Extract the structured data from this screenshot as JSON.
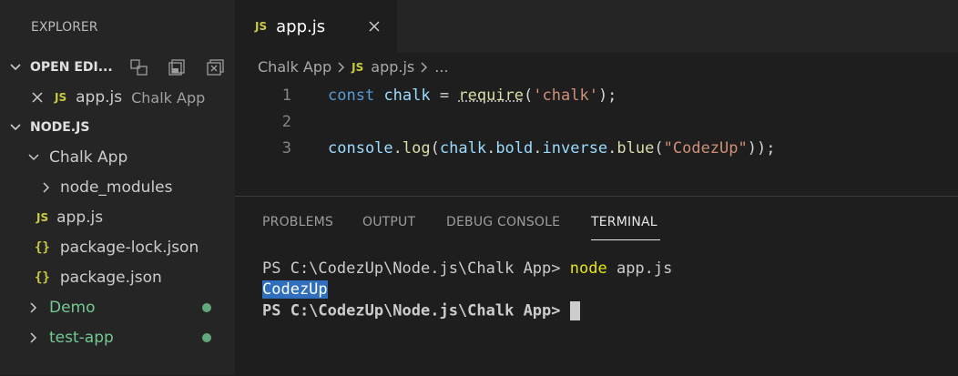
{
  "sidebar": {
    "title": "EXPLORER",
    "open_editors": {
      "label": "OPEN EDI...",
      "items": [
        {
          "name": "app.js",
          "folder": "Chalk App",
          "badge": "JS"
        }
      ]
    },
    "workspace": {
      "label": "NODE.JS",
      "tree": [
        {
          "label": "Chalk App"
        },
        {
          "label": "node_modules"
        },
        {
          "label": "app.js",
          "badge": "JS"
        },
        {
          "label": "package-lock.json",
          "badge": "{}"
        },
        {
          "label": "package.json",
          "badge": "{}"
        },
        {
          "label": "Demo"
        },
        {
          "label": "test-app"
        }
      ]
    }
  },
  "editor": {
    "tab": {
      "badge": "JS",
      "label": "app.js"
    },
    "breadcrumb": {
      "folder": "Chalk App",
      "badge": "JS",
      "file": "app.js",
      "more": "..."
    },
    "lines": [
      {
        "num": "1"
      },
      {
        "num": "2"
      },
      {
        "num": "3"
      }
    ],
    "code": {
      "line1": {
        "kw": "const",
        "var": "chalk",
        "eq": "=",
        "fn": "require",
        "open": "(",
        "str": "'chalk'",
        "close": ");"
      },
      "line3": {
        "obj": "console",
        "dot1": ".",
        "fn1": "log",
        "p1": "(",
        "ch": "chalk",
        "dot2": ".",
        "bold": "bold",
        "dot3": ".",
        "inv": "inverse",
        "dot4": ".",
        "fn2": "blue",
        "p2": "(",
        "str": "\"CodezUp\"",
        "close": "));"
      }
    }
  },
  "panel": {
    "tabs": [
      "PROBLEMS",
      "OUTPUT",
      "DEBUG CONSOLE",
      "TERMINAL"
    ],
    "active_tab": "TERMINAL",
    "terminal": {
      "prompt1": "PS C:\\CodezUp\\Node.js\\Chalk App> ",
      "cmd": "node",
      "arg": " app.js",
      "output": "CodezUp",
      "prompt2": "PS C:\\CodezUp\\Node.js\\Chalk App> "
    }
  },
  "colors": {
    "accent_green": "#73c991",
    "badge_yellow": "#cbcb41",
    "selection_blue": "#2f6fbe"
  }
}
